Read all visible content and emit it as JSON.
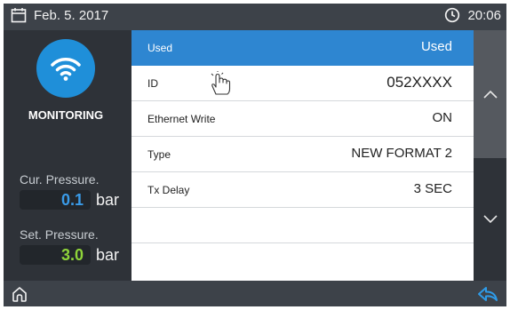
{
  "topbar": {
    "date": "Feb. 5. 2017",
    "time": "20:06",
    "date_icon": "calendar-icon",
    "time_icon": "clock-icon"
  },
  "left_panel": {
    "mode_icon": "wifi-icon",
    "mode_label": "MONITORING",
    "current_pressure": {
      "label": "Cur. Pressure.",
      "value": "0.1",
      "unit": "bar",
      "color": "#3a9be8"
    },
    "set_pressure": {
      "label": "Set. Pressure.",
      "value": "3.0",
      "unit": "bar",
      "color": "#8fd43a"
    }
  },
  "list": {
    "header": {
      "label": "Used",
      "value": "Used"
    },
    "rows": [
      {
        "label": "ID",
        "value": "052XXXX"
      },
      {
        "label": "Ethernet Write",
        "value": "ON"
      },
      {
        "label": "Type",
        "value": "NEW FORMAT 2"
      },
      {
        "label": "Tx Delay",
        "value": "3 SEC"
      },
      {
        "label": "",
        "value": ""
      }
    ]
  },
  "scroll": {
    "up_icon": "chevron-up-icon",
    "down_icon": "chevron-down-icon"
  },
  "bottombar": {
    "home_icon": "home-icon",
    "back_icon": "back-arrow-icon"
  },
  "colors": {
    "accent": "#2e86d1",
    "back_arrow": "#2e9be8"
  }
}
